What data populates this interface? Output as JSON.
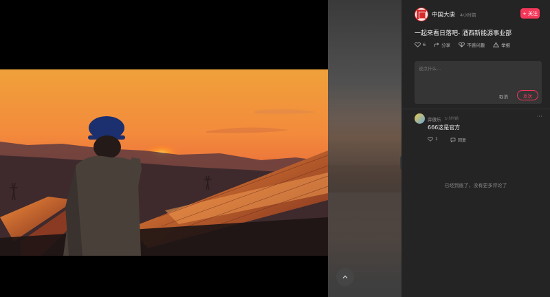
{
  "author": {
    "name": "中国大唐",
    "time": "4小时前",
    "follow_label": "+ 关注",
    "logo_icon": "datang-logo-icon"
  },
  "post": {
    "title": "一起来看日落吧- 酒西新能源事业部",
    "like_count": "6",
    "share_label": "分享",
    "not_interested_label": "不感兴趣",
    "report_label": "举报"
  },
  "comment_box": {
    "placeholder": "说点什么...",
    "cancel_label": "取消",
    "send_label": "发送"
  },
  "comments": [
    {
      "user": "弈傲乐",
      "time": "1小时前",
      "text": "666这是官方",
      "likes": "1",
      "reply_label": "回复"
    }
  ],
  "end_note": "已经到底了，没有更多评论了",
  "colors": {
    "accent": "#f5385a",
    "panel_bg": "#242424",
    "input_bg": "#353535"
  }
}
